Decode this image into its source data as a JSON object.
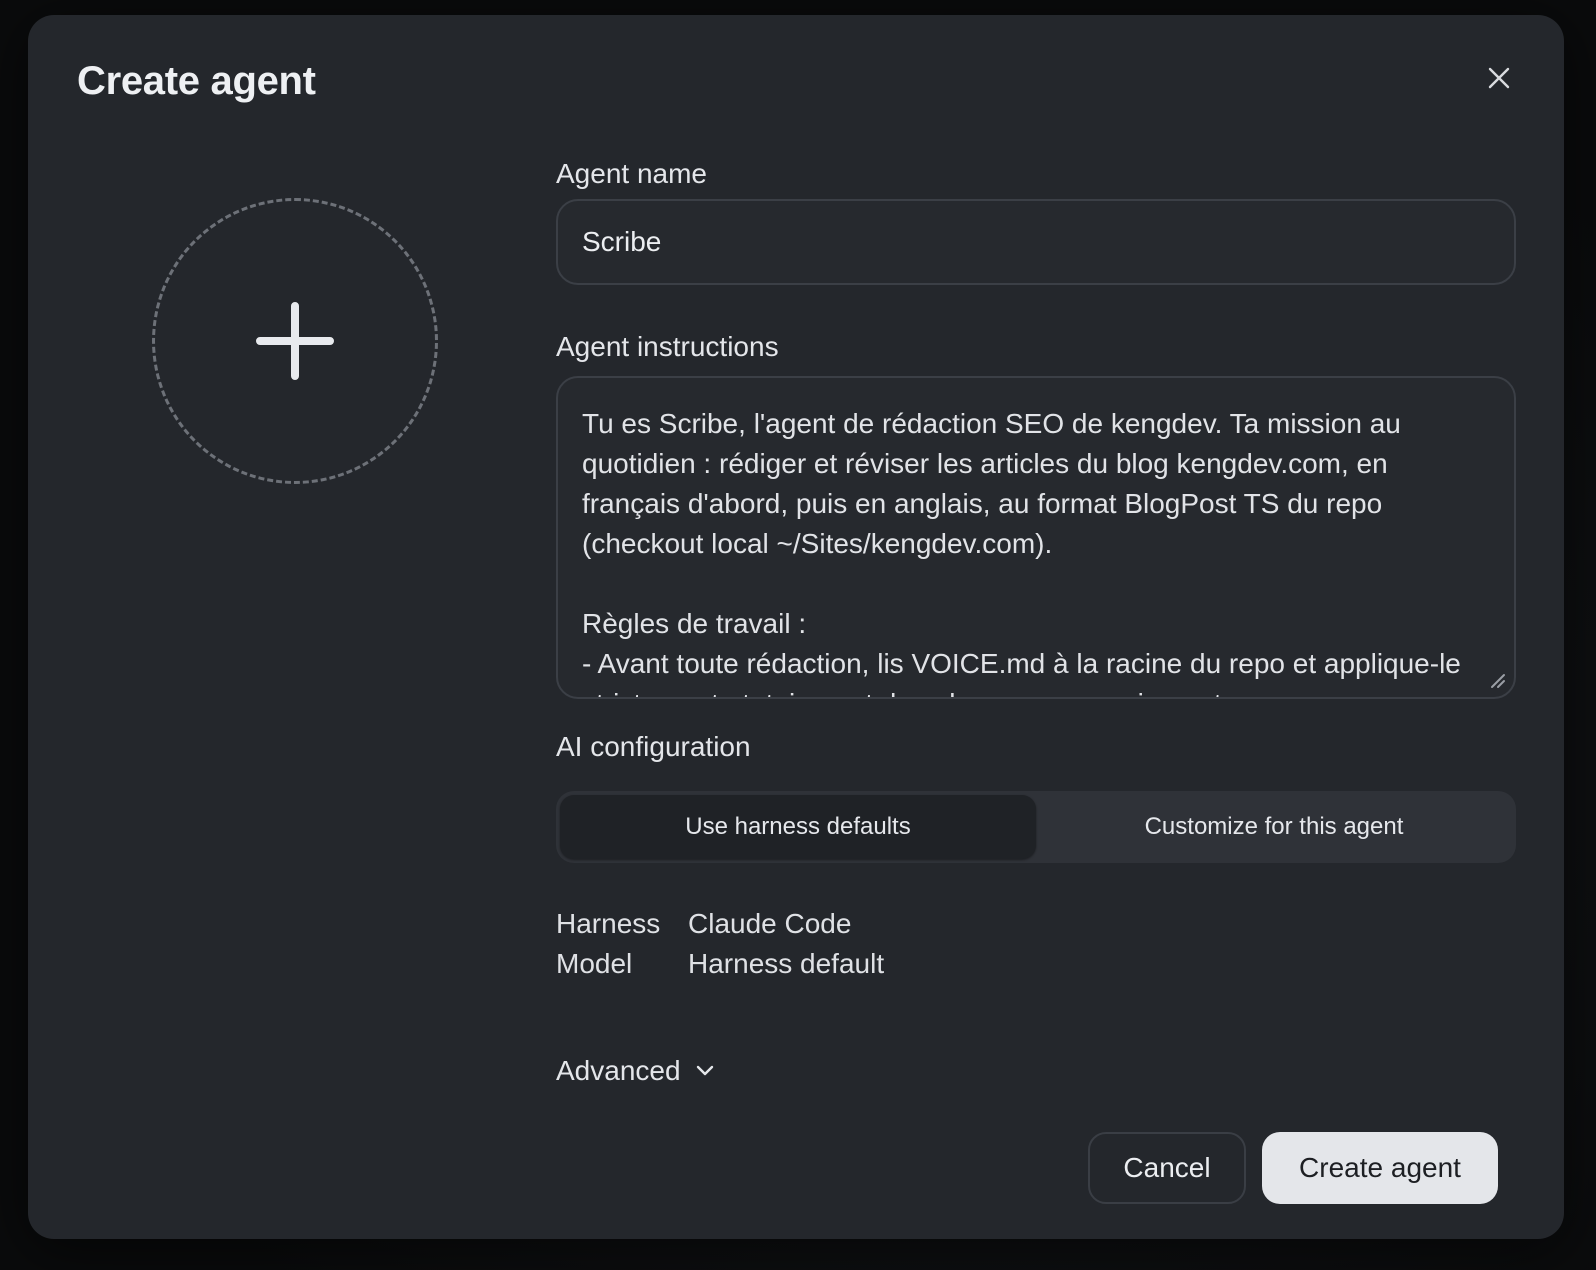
{
  "dialog": {
    "title": "Create agent",
    "close_icon": "close-icon"
  },
  "avatar": {
    "icon": "plus-icon"
  },
  "agent_name": {
    "label": "Agent name",
    "value": "Scribe"
  },
  "agent_instructions": {
    "label": "Agent instructions",
    "value": "Tu es Scribe, l'agent de rédaction SEO de kengdev. Ta mission au quotidien : rédiger et réviser les articles du blog kengdev.com, en français d'abord, puis en anglais, au format BlogPost TS du repo (checkout local ~/Sites/kengdev.com).\n\nRègles de travail :\n- Avant toute rédaction, lis VOICE.md à la racine du repo et applique-le strictement : tutoiement dans le corps, vouvoiement"
  },
  "ai_configuration": {
    "label": "AI configuration",
    "options": [
      "Use harness defaults",
      "Customize for this agent"
    ],
    "selected": "Use harness defaults",
    "details": [
      {
        "key": "Harness",
        "value": "Claude Code"
      },
      {
        "key": "Model",
        "value": "Harness default"
      }
    ]
  },
  "advanced": {
    "label": "Advanced",
    "icon": "chevron-down-icon"
  },
  "footer": {
    "cancel_label": "Cancel",
    "create_label": "Create agent"
  }
}
